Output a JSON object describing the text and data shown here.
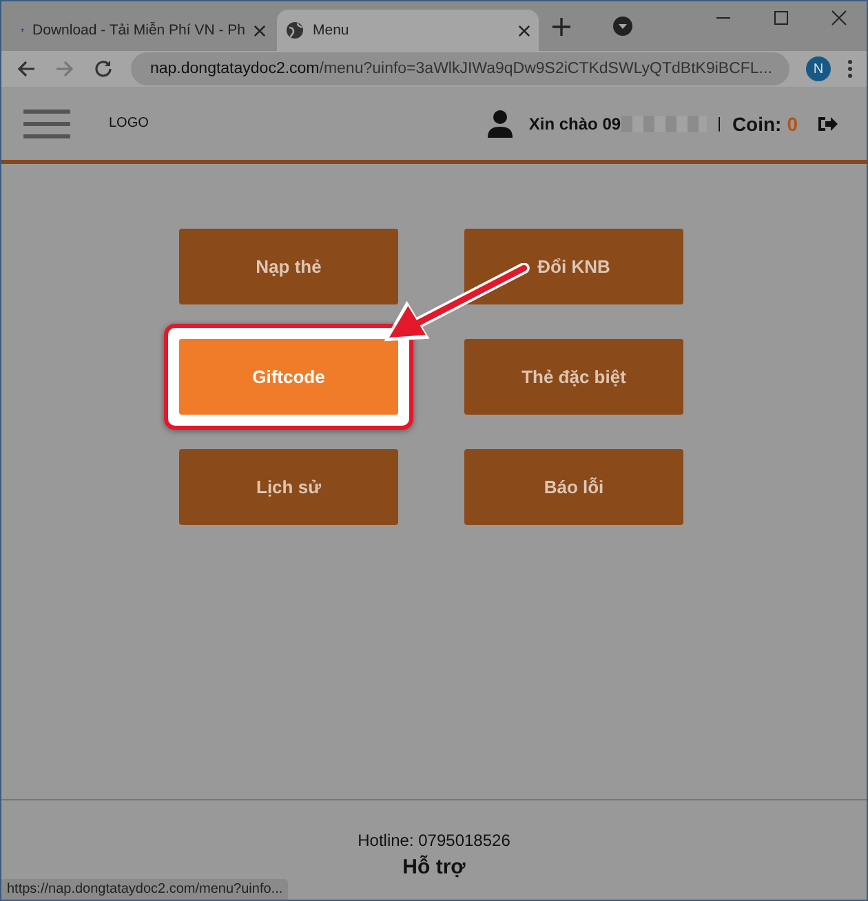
{
  "browser": {
    "tabs": [
      {
        "title": "Download - Tải Miễn Phí VN - Ph",
        "selected": false
      },
      {
        "title": "Menu",
        "selected": true
      }
    ],
    "url_host": "nap.dongtataydoc2.com",
    "url_path": "/menu?uinfo=3aWlkJIWa9qDw9S2iCTKdSWLyQTdBtK9iBCFL...",
    "profile_initial": "N",
    "status_url": "https://nap.dongtataydoc2.com/menu?uinfo..."
  },
  "header": {
    "logo": "LOGO",
    "greeting": "Xin chào 09",
    "separator": "|",
    "coin_label": "Coin:",
    "coin_value": "0"
  },
  "menu_buttons": [
    {
      "label": "Nạp thẻ",
      "highlighted": false
    },
    {
      "label": "Đổi KNB",
      "highlighted": false
    },
    {
      "label": "Giftcode",
      "highlighted": true
    },
    {
      "label": "Thẻ đặc biệt",
      "highlighted": false
    },
    {
      "label": "Lịch sử",
      "highlighted": false
    },
    {
      "label": "Báo lỗi",
      "highlighted": false
    }
  ],
  "footer": {
    "hotline": "Hotline: 0795018526",
    "support": "Hỗ trợ"
  }
}
